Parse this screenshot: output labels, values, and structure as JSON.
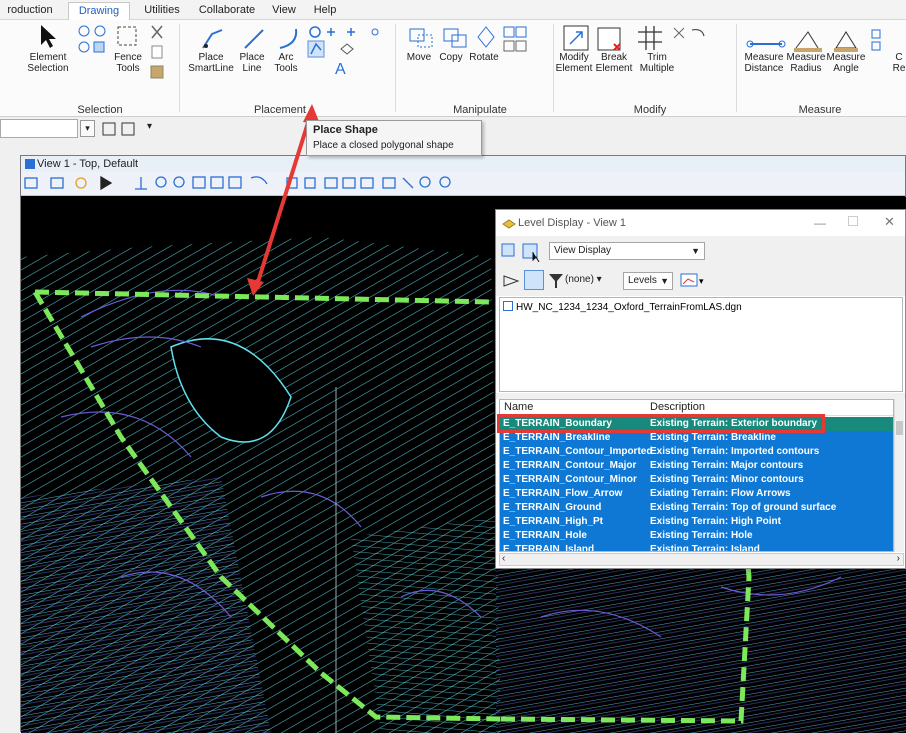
{
  "ribbon": {
    "tabs": [
      "roduction",
      "Drawing",
      "Utilities",
      "Collaborate",
      "View",
      "Help"
    ],
    "active_tab": "Drawing",
    "groups": {
      "selection": {
        "title": "Selection",
        "element_selection": "Element\nSelection",
        "fence_tools": "Fence\nTools"
      },
      "placement": {
        "title": "Placement",
        "place_smartline": "Place\nSmartLine",
        "place_line": "Place\nLine",
        "arc_tools": "Arc\nTools",
        "text_a": "A"
      },
      "manipulate": {
        "title": "Manipulate",
        "move": "Move",
        "copy": "Copy",
        "rotate": "Rotate"
      },
      "modify": {
        "title": "Modify",
        "modify_element": "Modify\nElement",
        "break_element": "Break\nElement",
        "trim_multiple": "Trim\nMultiple"
      },
      "measure": {
        "title": "Measure",
        "measure_distance": "Measure\nDistance",
        "measure_radius": "Measure\nRadius",
        "measure_angle": "Measure\nAngle",
        "edge1": "C",
        "edge2": "Re"
      }
    }
  },
  "tooltip": {
    "title": "Place Shape",
    "description": "Place a closed polygonal shape"
  },
  "view": {
    "title": "View 1 - Top, Default"
  },
  "level_dialog": {
    "title": "Level Display - View 1",
    "display_mode": "View Display",
    "filter": "(none)",
    "levels": "Levels",
    "file": "HW_NC_1234_1234_Oxford_TerrainFromLAS.dgn",
    "columns": {
      "name": "Name",
      "description": "Description"
    },
    "rows": [
      {
        "name": "E_TERRAIN_Boundary",
        "description": "Existing Terrain: Exterior boundary"
      },
      {
        "name": "E_TERRAIN_Breakline",
        "description": "Existing Terrain: Breakline"
      },
      {
        "name": "E_TERRAIN_Contour_Imported",
        "description": "Existing Terrain: Imported contours"
      },
      {
        "name": "E_TERRAIN_Contour_Major",
        "description": "Existing Terrain: Major contours"
      },
      {
        "name": "E_TERRAIN_Contour_Minor",
        "description": "Existing Terrain: Minor contours"
      },
      {
        "name": "E_TERRAIN_Flow_Arrow",
        "description": "Exiating Terrain: Flow Arrows"
      },
      {
        "name": "E_TERRAIN_Ground",
        "description": "Existing Terrain: Top of ground surface"
      },
      {
        "name": "E_TERRAIN_High_Pt",
        "description": "Existing Terrain: High Point"
      },
      {
        "name": "E_TERRAIN_Hole",
        "description": "Existing Terrain: Hole"
      },
      {
        "name": "E_TERRAIN_Island",
        "description": "Existing Terrain: Island"
      }
    ]
  },
  "colors": {
    "terrain_cyan": "#5fe0ee",
    "terrain_purple": "#6b5bd6",
    "boundary_green": "#7ce85a",
    "callout_red": "#e53935",
    "selection_blue": "#0e78d4",
    "selected_row_teal": "#17897d"
  }
}
